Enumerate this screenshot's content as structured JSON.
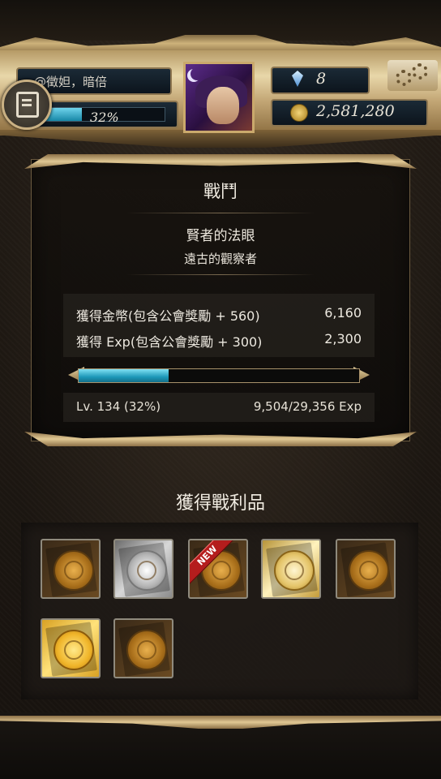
{
  "header": {
    "player_name": "@徵妲，暗倍",
    "exp_percent_label": "32%",
    "exp_fraction": 0.32,
    "gems": "8",
    "gold": "2,581,280"
  },
  "battle": {
    "title": "戰鬥",
    "enemy_name": "賢者的法眼",
    "enemy_subtitle": "遠古的觀察者",
    "rewards": [
      {
        "label": "獲得金幣(包含公會獎勵 + 560)",
        "value": "6,160"
      },
      {
        "label": "獲得 Exp(包含公會獎勵 + 300)",
        "value": "2,300"
      }
    ],
    "level_progress_fraction": 0.32,
    "level_label": "Lv. 134 (32%)",
    "exp_label": "9,504/29,356 Exp"
  },
  "loot": {
    "title": "獲得戰利品",
    "new_badge": "NEW",
    "items": [
      {
        "type": "bronze",
        "new": false
      },
      {
        "type": "silver",
        "new": false
      },
      {
        "type": "bronze",
        "new": true
      },
      {
        "type": "gold",
        "new": false
      },
      {
        "type": "bronze",
        "new": false
      },
      {
        "type": "goldbright",
        "new": false
      },
      {
        "type": "bronze",
        "new": false
      }
    ]
  },
  "colors": {
    "exp_bar": "#1787a6",
    "frame_gold": "#cdb27a",
    "new_ribbon": "#b41d1d"
  },
  "icons": [
    "menu-icon",
    "gem-icon",
    "gold-coin-icon",
    "settings-gear-icon",
    "avatar-portrait"
  ]
}
